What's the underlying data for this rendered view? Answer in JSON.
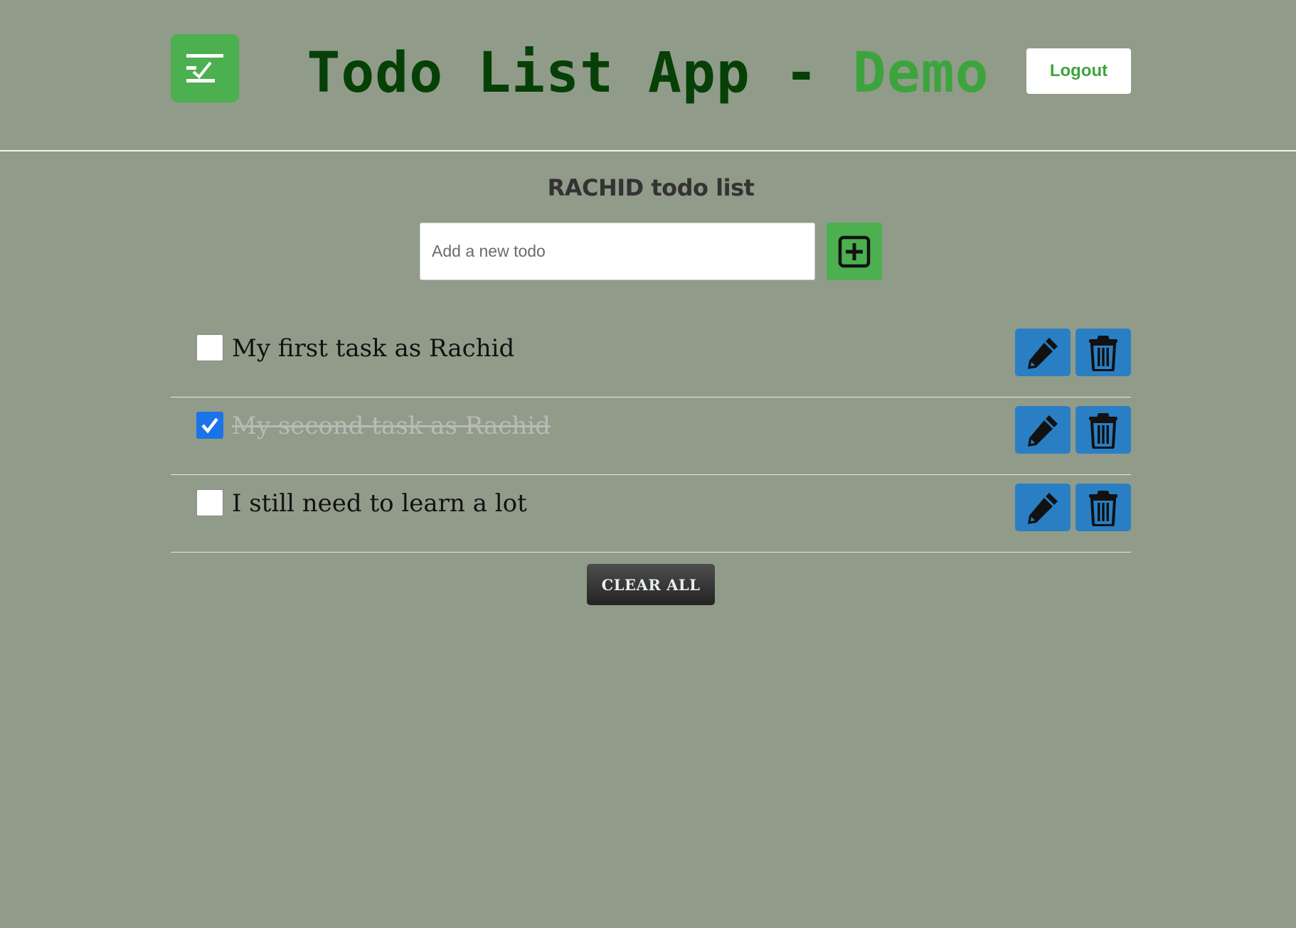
{
  "header": {
    "title_main": "Todo List App -",
    "title_demo": "Demo",
    "logout_label": "Logout",
    "logo_icon": "checklist-icon"
  },
  "main": {
    "list_title": "RACHID todo list",
    "input": {
      "placeholder": "Add a new todo",
      "value": ""
    },
    "add_icon": "plus-square-icon",
    "todos": [
      {
        "text": "My first task as Rachid",
        "completed": false
      },
      {
        "text": "My second task as Rachid",
        "completed": true
      },
      {
        "text": "I still need to learn a lot",
        "completed": false
      }
    ],
    "edit_icon": "pencil-icon",
    "delete_icon": "trash-icon",
    "clear_all_label": "CLEAR ALL"
  },
  "colors": {
    "background": "#919b89",
    "accent_green": "#4caf50",
    "title_dark_green": "#064006",
    "title_light_green": "#3da43d",
    "action_blue": "#2a7fc4",
    "checkbox_blue": "#1a73e8"
  }
}
